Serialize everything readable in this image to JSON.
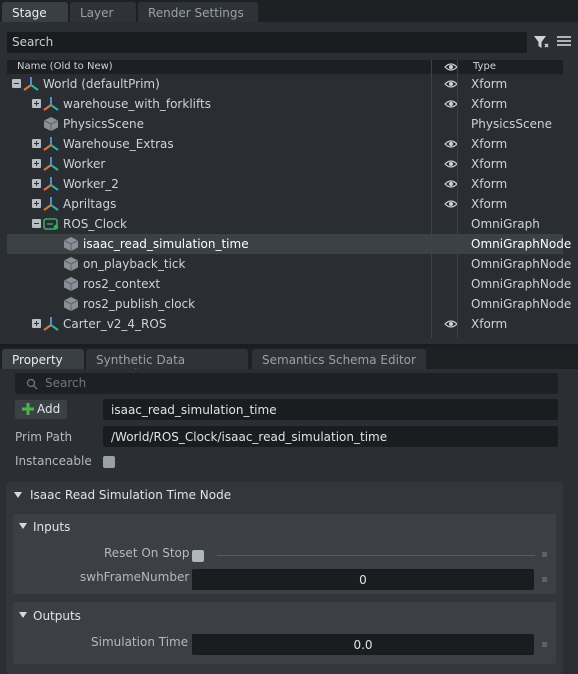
{
  "stage_tabs": [
    "Stage",
    "Layer",
    "Render Settings"
  ],
  "stage_search": {
    "placeholder": "Search"
  },
  "tree_header": {
    "name": "Name (Old to New)",
    "type": "Type"
  },
  "tree": [
    {
      "name": "World (defaultPrim)",
      "type": "Xform",
      "indent": 0,
      "expander": "minus",
      "icon": "xform-axes-icon",
      "visible": true
    },
    {
      "name": "warehouse_with_forklifts",
      "type": "Xform",
      "indent": 1,
      "expander": "plus",
      "icon": "xform-axes-icon",
      "visible": true
    },
    {
      "name": "PhysicsScene",
      "type": "PhysicsScene",
      "indent": 1,
      "expander": null,
      "icon": "cube-icon",
      "visible": false
    },
    {
      "name": "Warehouse_Extras",
      "type": "Xform",
      "indent": 1,
      "expander": "plus",
      "icon": "xform-axes-icon",
      "visible": true
    },
    {
      "name": "Worker",
      "type": "Xform",
      "indent": 1,
      "expander": "plus",
      "icon": "xform-axes-icon",
      "visible": true
    },
    {
      "name": "Worker_2",
      "type": "Xform",
      "indent": 1,
      "expander": "plus",
      "icon": "xform-axes-icon",
      "visible": true
    },
    {
      "name": "Apriltags",
      "type": "Xform",
      "indent": 1,
      "expander": "plus",
      "icon": "xform-axes-icon",
      "visible": true
    },
    {
      "name": "ROS_Clock",
      "type": "OmniGraph",
      "indent": 1,
      "expander": "minus",
      "icon": "graph-icon",
      "visible": false
    },
    {
      "name": "isaac_read_simulation_time",
      "type": "OmniGraphNode",
      "indent": 2,
      "expander": null,
      "icon": "cube-icon",
      "visible": false,
      "selected": true
    },
    {
      "name": "on_playback_tick",
      "type": "OmniGraphNode",
      "indent": 2,
      "expander": null,
      "icon": "cube-icon",
      "visible": false
    },
    {
      "name": "ros2_context",
      "type": "OmniGraphNode",
      "indent": 2,
      "expander": null,
      "icon": "cube-icon",
      "visible": false
    },
    {
      "name": "ros2_publish_clock",
      "type": "OmniGraphNode",
      "indent": 2,
      "expander": null,
      "icon": "cube-icon",
      "visible": false
    },
    {
      "name": "Carter_v2_4_ROS",
      "type": "Xform",
      "indent": 1,
      "expander": "plus",
      "icon": "xform-axes-icon",
      "visible": true
    }
  ],
  "prop_tabs": [
    "Property",
    "Synthetic Data Recorder",
    "Semantics Schema Editor"
  ],
  "property": {
    "search_placeholder": "Search",
    "add_label": "Add",
    "prim_name": "isaac_read_simulation_time",
    "prim_path_label": "Prim Path",
    "prim_path": "/World/ROS_Clock/isaac_read_simulation_time",
    "instanceable_label": "Instanceable",
    "node_section": "Isaac Read Simulation Time Node",
    "inputs_title": "Inputs",
    "reset_on_stop_label": "Reset On Stop",
    "swh_frame_label": "swhFrameNumber",
    "swh_frame_value": "0",
    "outputs_title": "Outputs",
    "sim_time_label": "Simulation Time",
    "sim_time_value": "0.0"
  },
  "colors": {
    "xform_orange": "#e07a2c",
    "xform_blue": "#4c8fd6",
    "xform_teal": "#2fb3a5",
    "cube_grey": "#8a9097",
    "graph_green": "#3aa86a",
    "add_green": "#4fb04f"
  }
}
